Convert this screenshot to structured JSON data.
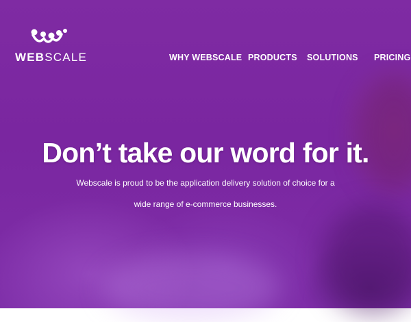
{
  "brand": {
    "logo_mark": "webscale-logo-icon",
    "name_bold": "WEB",
    "name_light": "SCALE"
  },
  "nav": {
    "items": [
      {
        "label": "WHY WEBSCALE"
      },
      {
        "label": "PRODUCTS"
      },
      {
        "label": "SOLUTIONS"
      },
      {
        "label": "PRICING"
      }
    ]
  },
  "hero": {
    "headline": "Don’t take our word for it.",
    "subtext_line1": "Webscale is proud to be the application delivery solution of choice for a",
    "subtext_line2": "wide range of e-commerce businesses."
  },
  "colors": {
    "overlay": "#7a26a0",
    "text": "#ffffff"
  }
}
